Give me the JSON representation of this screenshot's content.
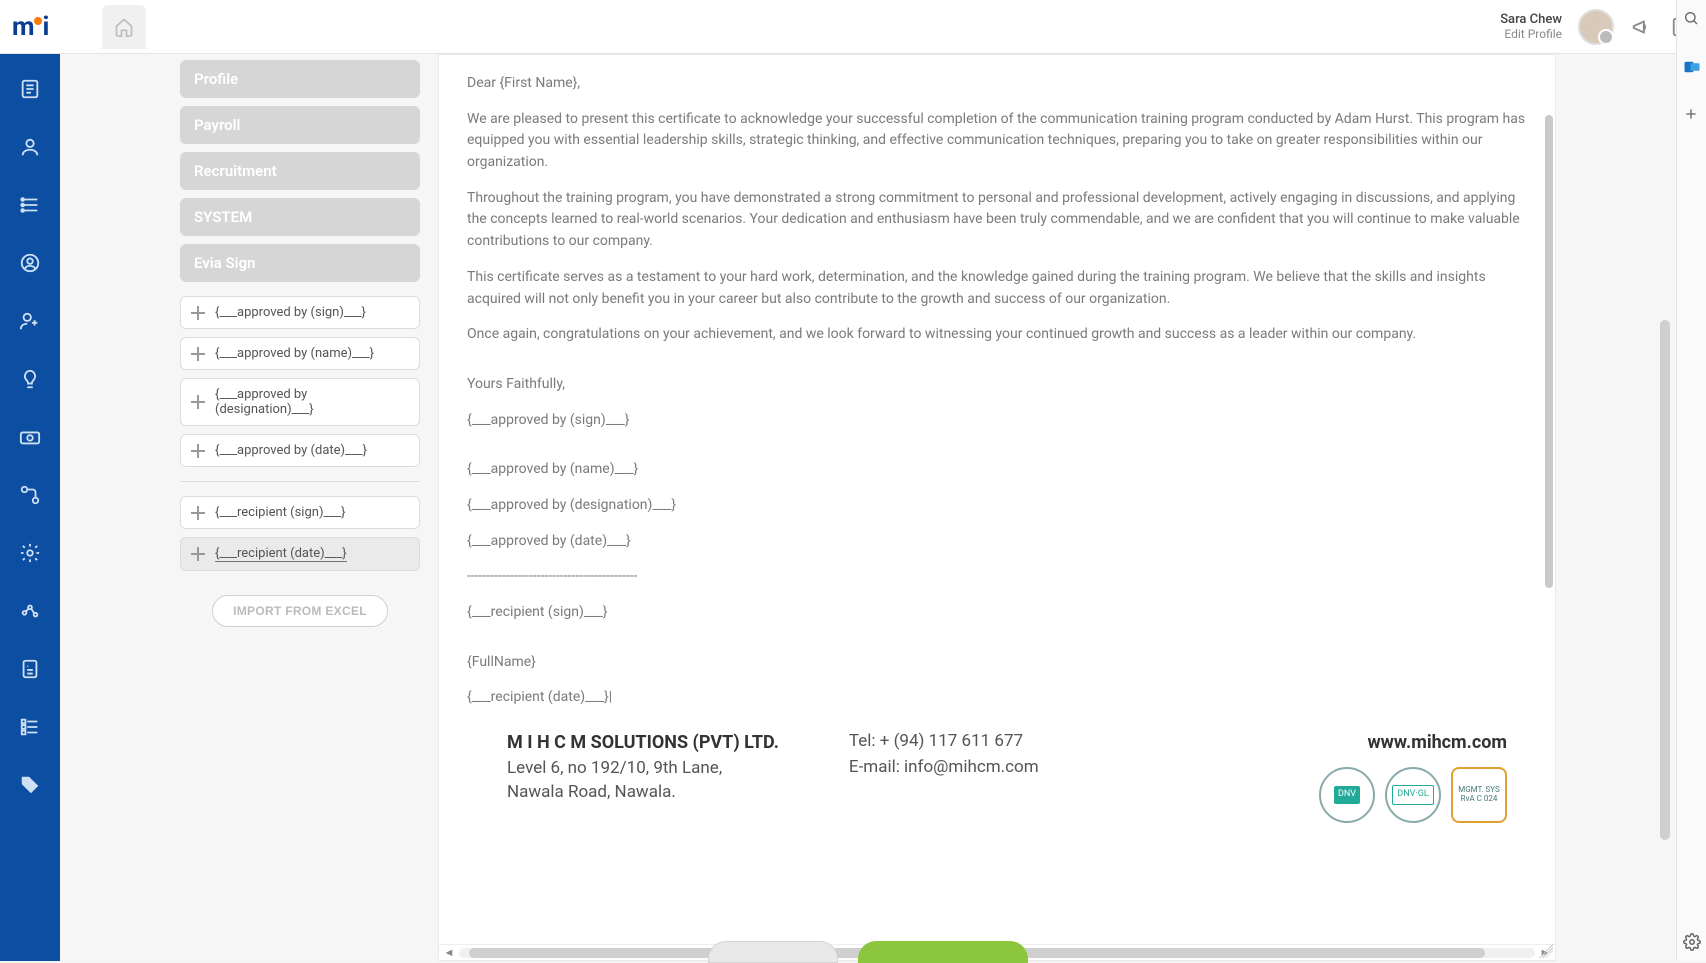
{
  "header": {
    "user_name": "Sara Chew",
    "edit_profile": "Edit Profile"
  },
  "side": {
    "sections": {
      "profile": "Profile",
      "payroll": "Payroll",
      "recruitment": "Recruitment",
      "system": "SYSTEM",
      "evia": "Evia Sign"
    },
    "fields": {
      "approved_sign": "{___approved by (sign)___}",
      "approved_name": "{___approved by (name)___}",
      "approved_designation": "{___approved by (designation)___}",
      "approved_date": "{___approved by (date)___}",
      "recipient_sign": "{___recipient (sign)___}",
      "recipient_date": "{___recipient (date)___}"
    },
    "import_btn": "IMPORT FROM EXCEL"
  },
  "doc": {
    "greeting": "Dear {First Name},",
    "para1": "We are pleased to present this certificate to acknowledge your successful completion of the communication training program conducted by Adam Hurst. This program has equipped you with essential leadership skills, strategic thinking, and effective communication techniques, preparing you to take on greater responsibilities within our organization.",
    "para2": "Throughout the training program, you have demonstrated a strong commitment to personal and professional development, actively engaging in discussions, and applying the concepts learned to real-world scenarios. Your dedication and enthusiasm have been truly commendable, and we are confident that you will continue to make valuable contributions to our company.",
    "para3": "This certificate serves as a testament to your hard work, determination, and the knowledge gained during the training program. We believe that the skills and insights acquired will not only benefit you in your career but also contribute to the growth and success of our organization.",
    "para4": "Once again, congratulations on your achievement, and we look forward to witnessing your continued growth and success as a leader within our company.",
    "closing": "Yours Faithfully,",
    "token_approved_sign": "{___approved by (sign)___}",
    "token_approved_name": "{___approved by (name)___}",
    "token_approved_designation": "{___approved by (designation)___}",
    "token_approved_date": "{___approved by (date)___}",
    "separator": "--------------------------------------------",
    "token_recipient_sign": "{___recipient (sign)___}",
    "fullname": "{FullName}",
    "token_recipient_date": "{___recipient (date)___}|"
  },
  "footer": {
    "company": "M I H C M SOLUTIONS (PVT) LTD.",
    "addr1": "Level 6, no 192/10, 9th Lane,",
    "addr2": "Nawala Road, Nawala.",
    "tel": "Tel:  + (94) 117 611 677",
    "email": "E-mail: info@mihcm.com",
    "web": "www.mihcm.com",
    "badge1": "DNV",
    "badge2": "DNV·GL",
    "badge3a": "MGMT. SYS",
    "badge3b": "RvA C 024"
  }
}
